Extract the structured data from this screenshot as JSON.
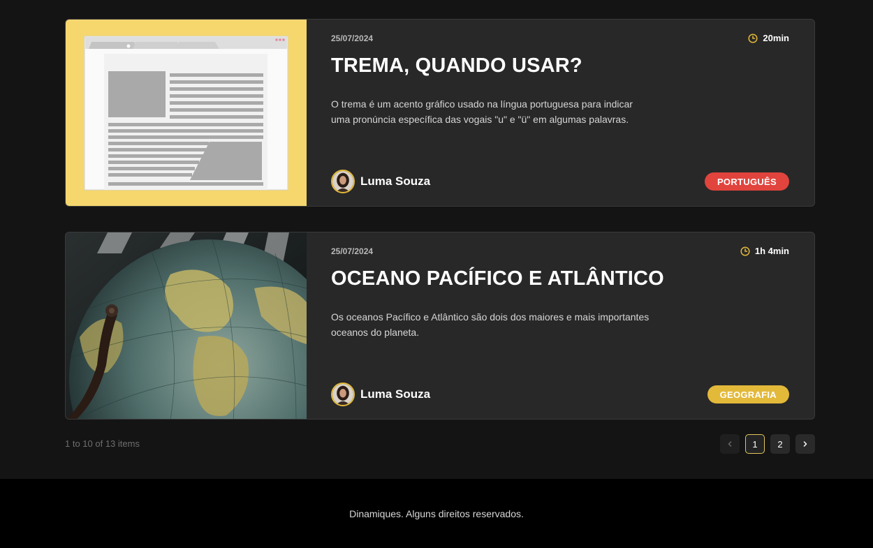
{
  "articles": [
    {
      "date": "25/07/2024",
      "duration": "20min",
      "title": "TREMA, QUANDO USAR?",
      "description": "O trema é um acento gráfico usado na língua portuguesa para indicar uma pronúncia específica das vogais \"u\" e \"ü\" em algumas palavras.",
      "author": "Luma Souza",
      "tag": "PORTUGUÊS",
      "tag_color": "#e0443d",
      "tag_text_color": "#ffffff",
      "thumbnail_icon": "webpage-illustration",
      "thumbnail_bg": "#f5d76e"
    },
    {
      "date": "25/07/2024",
      "duration": "1h 4min",
      "title": "OCEANO PACÍFICO E ATLÂNTICO",
      "description": "Os oceanos Pacífico e Atlântico são dois dos maiores e mais importantes oceanos do planeta.",
      "author": "Luma Souza",
      "tag": "GEOGRAFIA",
      "tag_color": "#e3b93a",
      "tag_text_color": "#ffffff",
      "thumbnail_icon": "globe-photo"
    }
  ],
  "pagination": {
    "info": "1 to 10 of 13 items",
    "prev_icon": "chevron-left-icon",
    "pages": [
      "1",
      "2"
    ],
    "current": "1",
    "next_icon": "chevron-right-icon"
  },
  "footer": {
    "text": "Dinamiques. Alguns direitos reservados."
  },
  "colors": {
    "accent": "#e3b93a",
    "card_bg": "#282828",
    "page_bg": "#141414"
  }
}
